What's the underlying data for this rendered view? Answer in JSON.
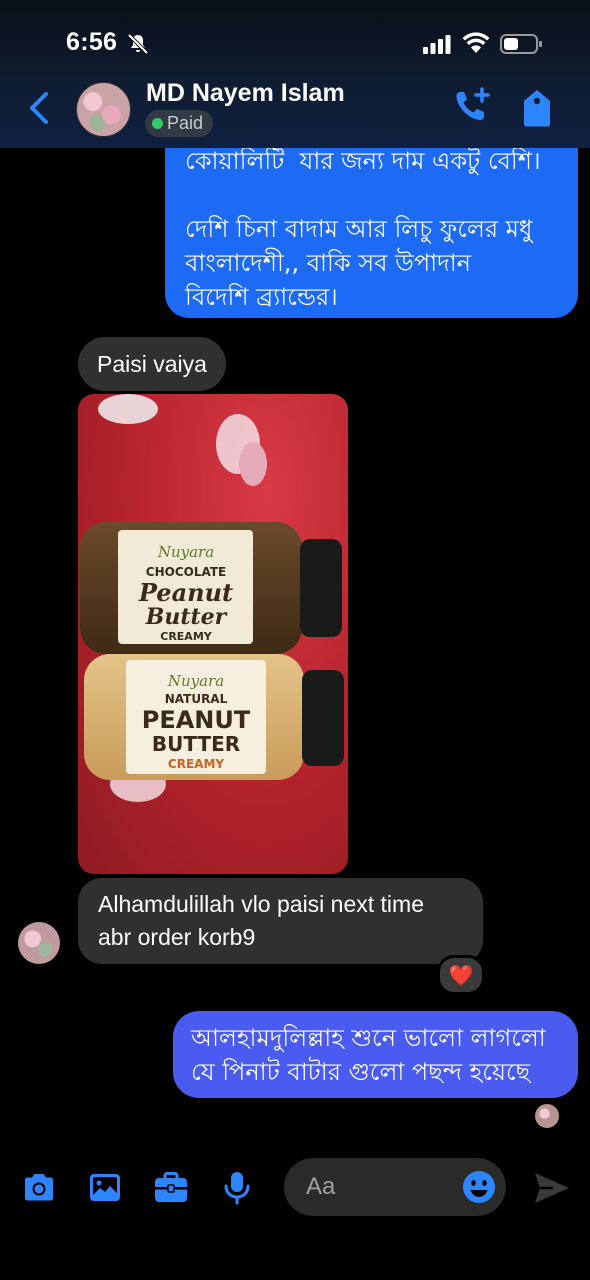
{
  "status_bar": {
    "time": "6:56"
  },
  "header": {
    "contact_name": "MD Nayem Islam",
    "status_label": "Paid",
    "status_color": "#31cc6a",
    "icons": [
      "back-arrow-icon",
      "phone-plus-icon",
      "tag-icon"
    ]
  },
  "messages": [
    {
      "direction": "outgoing",
      "text": "কোয়ালিটি  যার জন্য দাম একটু বেশি।\n\nদেশি চিনা বাদাম আর লিচু ফুলের মধু\nবাংলাদেশী,, বাকি সব উপাদান\nবিদেশি ব্র্যান্ডের।"
    },
    {
      "direction": "incoming",
      "text": "Paisi vaiya"
    },
    {
      "direction": "incoming",
      "type": "photo"
    },
    {
      "direction": "incoming",
      "text": "Alhamdulillah vlo paisi next time\nabr order korb9",
      "reaction": "❤️"
    },
    {
      "direction": "outgoing",
      "text": "আলহামদুলিল্লাহ শুনে ভালো লাগলো\nযে পিনাট বাটার গুলো পছন্দ হয়েছে"
    }
  ],
  "photo_labels": {
    "jar1": {
      "brand": "Nuyara",
      "flavor": "CHOCOLATE",
      "line1": "Peanut",
      "line2": "Butter",
      "line3": "CREAMY"
    },
    "jar2": {
      "brand": "Nuyara",
      "flavor": "NATURAL",
      "line1": "PEANUT",
      "line2": "BUTTER",
      "line3": "CREAMY"
    }
  },
  "composer": {
    "placeholder": "Aa",
    "icons": [
      "camera-icon",
      "image-icon",
      "briefcase-icon",
      "microphone-icon",
      "emoji-icon",
      "send-icon"
    ]
  },
  "colors": {
    "outgoing_bubble": "#1d6af5",
    "outgoing_bubble_2": "#4a5bf0",
    "incoming_bubble": "#303030",
    "accent": "#1877f2"
  }
}
